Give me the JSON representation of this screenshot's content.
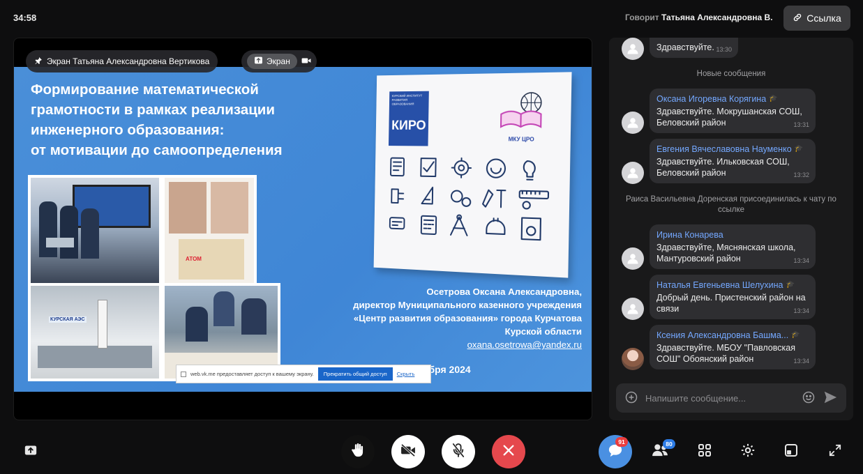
{
  "header": {
    "timer": "34:58",
    "speaker_prefix": "Говорит",
    "speaker_name": "Татьяна Александровна В.",
    "link_label": "Ссылка"
  },
  "stage": {
    "pinned_label": "Экран Татьяна Александровна Вертикова",
    "screen_label": "Экран"
  },
  "slide": {
    "title_lines": [
      "Формирование математической",
      "грамотности в рамках реализации",
      "инженерного образования:",
      "от мотивации до самоопределения"
    ],
    "author_lines": [
      "Осетрова Оксана Александровна,",
      "директор Муниципального казенного учреждения",
      "«Центр развития образования» города Курчатова",
      "Курской области"
    ],
    "email": "oxana.osetrowa@yandex.ru",
    "date": "26 ноября 2024",
    "poster_logo_top": "КУРСКИЙ ИНСТИТУТ РАЗВИТИЯ ОБРАЗОВАНИЯ",
    "poster_logo_main": "КИРО",
    "poster_logo_right": "МКУ ЦРО",
    "photo_sign": "КУРСКАЯ АЭС",
    "photo_sign2": "АТОМ"
  },
  "share_bar": {
    "text": "web.vk.me предоставляет доступ к вашему экрану.",
    "stop_label": "Прекратить общий доступ",
    "hide_label": "Скрыть"
  },
  "chat": {
    "first_msg": {
      "text": "Здравствуйте.",
      "time": "13:30"
    },
    "new_divider": "Новые сообщения",
    "messages": [
      {
        "name": "Оксана Игоревна Корягина",
        "text": "Здравствуйте. Мокрушанская СОШ, Беловский район",
        "time": "13:31"
      },
      {
        "name": "Евгения Вячеславовна Науменко",
        "text": "Здравствуйте. Ильковская СОШ, Беловский район",
        "time": "13:32"
      },
      {
        "name": "Ирина Конарева",
        "text": "Здравствуйте, Мяснянская школа, Мантуровский район",
        "time": "13:34"
      },
      {
        "name": "Наталья Евгеньевна Шелухина",
        "text": "Добрый день. Пристенский район на связи",
        "time": "13:34"
      },
      {
        "name": "Ксения Александровна Башма...",
        "text": "Здравствуйте. МБОУ \"Павловская СОШ\" Обоянский район",
        "time": "13:34"
      }
    ],
    "system_msg": "Раиса Васильевна Доренская присоединилась к чату по ссылке",
    "composer_placeholder": "Напишите сообщение..."
  },
  "toolbar": {
    "chat_badge": "91",
    "participants_badge": "80"
  },
  "colors": {
    "accent": "#4a90e2",
    "end_call": "#e5484d",
    "slide_bg": "#4a8fd8",
    "name_link": "#74a8ff"
  }
}
